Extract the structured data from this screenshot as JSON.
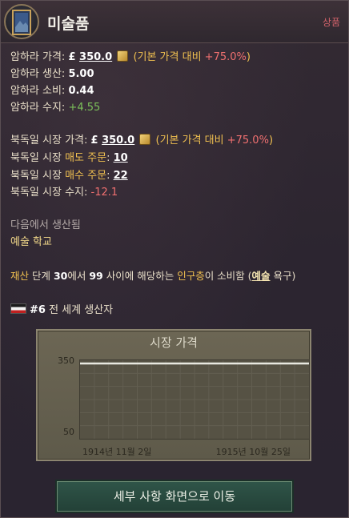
{
  "header": {
    "title": "미술품",
    "category": "상품",
    "icon": "painting-icon"
  },
  "local_market": {
    "price_label": "암하라 가격:",
    "price_value": "350.0",
    "price_note_prefix": "(기본 가격 대비 ",
    "price_note_pct": "+75.0%",
    "price_note_suffix": ")",
    "production_label": "암하라 생산:",
    "production_value": "5.00",
    "consumption_label": "암하라 소비:",
    "consumption_value": "0.44",
    "balance_label": "암하라 수지:",
    "balance_value": "+4.55"
  },
  "national_market": {
    "price_label": "북독일 시장 가격:",
    "price_value": "350.0",
    "price_note_prefix": "(기본 가격 대비 ",
    "price_note_pct": "+75.0%",
    "price_note_suffix": ")",
    "sell_label_a": "북독일 시장 ",
    "sell_label_b": "매도 주문",
    "sell_value": "10",
    "buy_label_a": "북독일 시장 ",
    "buy_label_b": "매수 주문",
    "buy_value": "22",
    "balance_label": "북독일 시장 수지:",
    "balance_value": "-12.1"
  },
  "produced_in": {
    "label": "다음에서 생산됨",
    "building": "예술 학교"
  },
  "consumption_note": {
    "wealth": "재산",
    "text1": " 단계 ",
    "from": "30",
    "text2": "에서 ",
    "to": "99",
    "text3": " 사이에 해당하는 ",
    "pop": "인구층",
    "text4": "이 소비함 (",
    "need": "예술",
    "text5": " 욕구)"
  },
  "ranking": {
    "rank": "#6",
    "text": "전 세계 생산자"
  },
  "chart_data": {
    "type": "line",
    "title": "시장 가격",
    "x": [
      "1914년 11월 2일",
      "1915년 10월 25일"
    ],
    "series": [
      {
        "values": [
          350,
          350
        ]
      }
    ],
    "ylim": [
      50,
      350
    ],
    "y_ticks": [
      "350",
      "50"
    ],
    "x_ticks": [
      "1914년 11월 2일",
      "1915년 10월 25일"
    ],
    "grid": true,
    "line_color": "#e8e8e0"
  },
  "details_button": "세부 사항 화면으로 이동",
  "colors": {
    "positive": "#7cc05a",
    "negative": "#f07070",
    "highlight": "#f0c050"
  }
}
